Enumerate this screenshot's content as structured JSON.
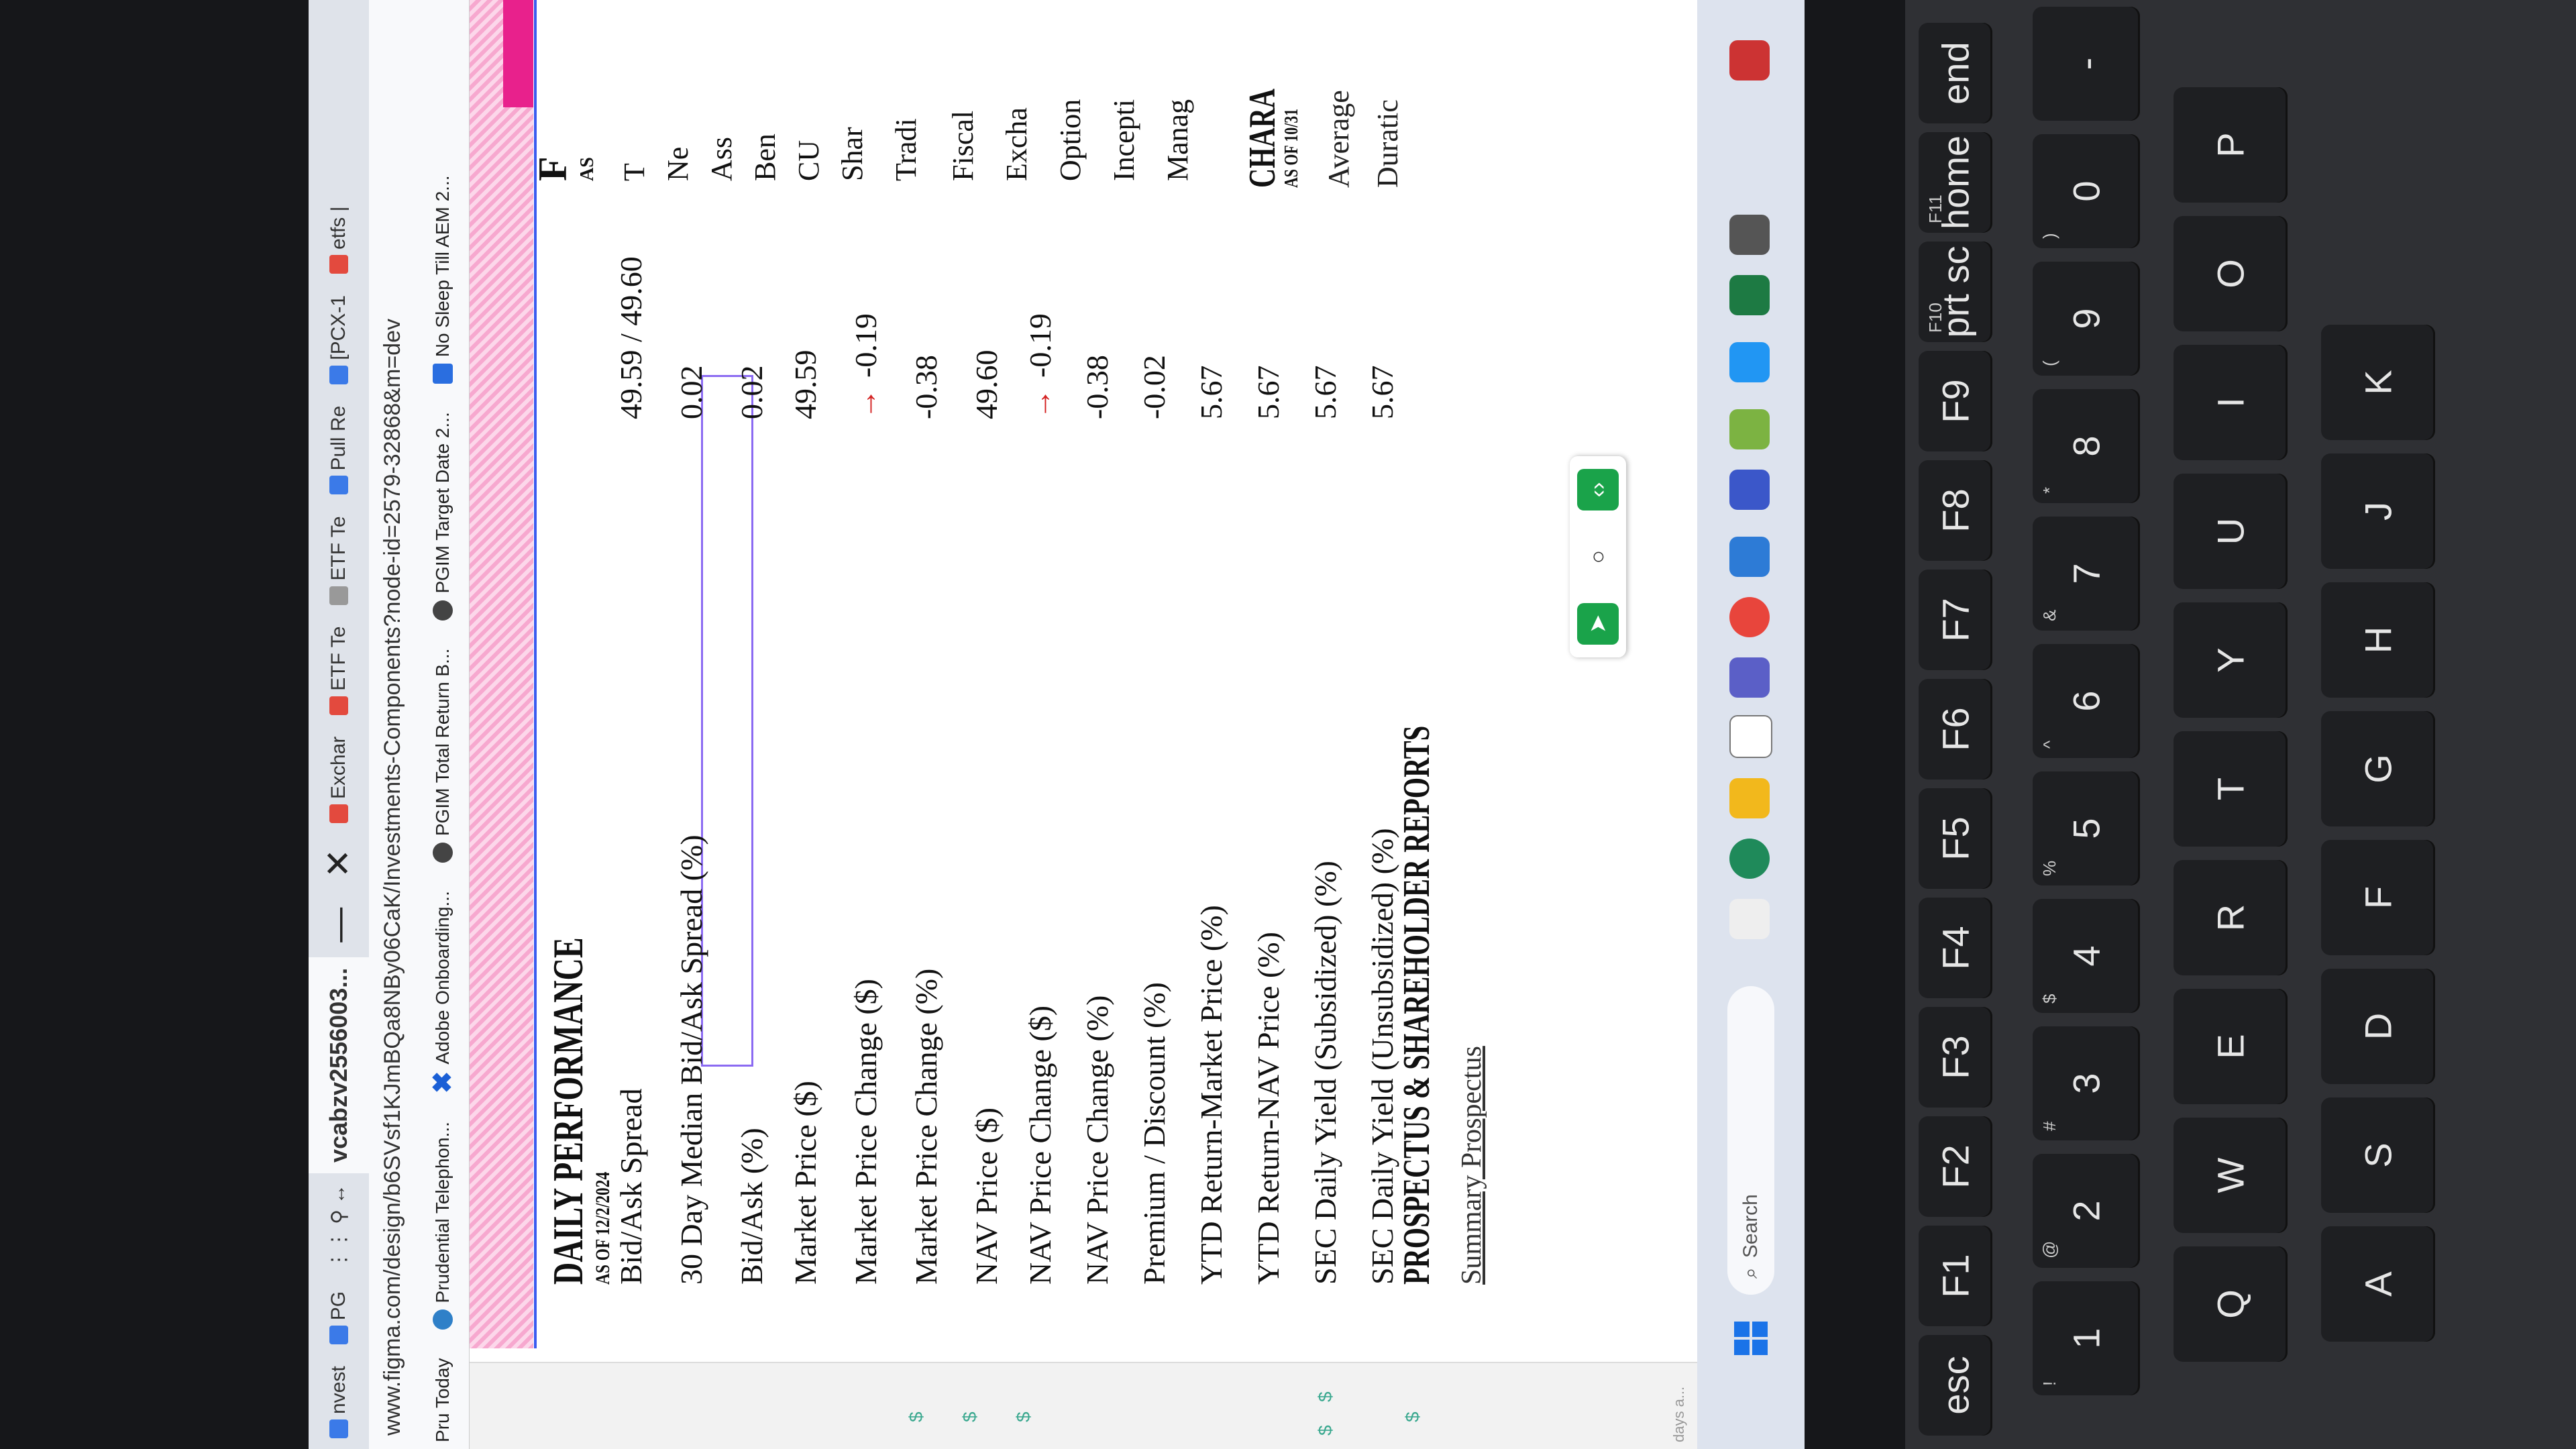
{
  "browser": {
    "tabs": [
      {
        "label": "nvest",
        "color": "#3b7ae8"
      },
      {
        "label": "PG",
        "color": "#3b7ae8"
      },
      {
        "label": "vcabzv2556003...",
        "color": "#555555",
        "active": true
      },
      {
        "label": "Exchar",
        "color": "#e34a3e"
      },
      {
        "label": "ETF Te",
        "color": "#888888"
      },
      {
        "label": "ETF Te",
        "color": "#888888"
      },
      {
        "label": "Pull Re",
        "color": "#3b7ae8"
      },
      {
        "label": "[PCX-1",
        "color": "#3b7ae8"
      },
      {
        "label": "etfs |",
        "color": "#e34a3e"
      }
    ],
    "close_glyph": "✕",
    "minimize_glyph": "—",
    "url": "www.figma.com/design/b6SVsf1KJmBQa8NBy06CaK/Investments-Components?node-id=2579-32868&m=dev",
    "bookmarks": [
      {
        "label": "Pru Today",
        "icon": "pru-icon"
      },
      {
        "label": "Prudential Telephon...",
        "icon": "globe-icon"
      },
      {
        "label": "Adobe Onboarding...",
        "icon": "adobe-x-icon"
      },
      {
        "label": "PGIM Total Return B...",
        "icon": "pgim-icon"
      },
      {
        "label": "PGIM Target Date 2...",
        "icon": "pgim-icon"
      },
      {
        "label": "No Sleep Till AEM 2...",
        "icon": "confluence-icon"
      }
    ]
  },
  "daily_performance": {
    "title": "DAILY PERFORMANCE",
    "as_of": "AS OF 12/2/2024",
    "rows": [
      {
        "label": "Bid/Ask Spread",
        "value": "49.59 / 49.60",
        "down": false
      },
      {
        "label": "30 Day Median Bid/Ask Spread (%)",
        "value": "0.02",
        "down": false
      },
      {
        "label": "Bid/Ask (%)",
        "value": "0.02",
        "down": false
      },
      {
        "label": "Market Price ($)",
        "value": "49.59",
        "down": false
      },
      {
        "label": "Market Price Change ($)",
        "value": "-0.19",
        "down": true
      },
      {
        "label": "Market Price Change (%)",
        "value": "-0.38",
        "down": false
      },
      {
        "label": "NAV Price ($)",
        "value": "49.60",
        "down": false
      },
      {
        "label": "NAV Price Change ($)",
        "value": "-0.19",
        "down": true
      },
      {
        "label": "NAV Price Change (%)",
        "value": "-0.38",
        "down": false
      },
      {
        "label": "Premium / Discount (%)",
        "value": "-0.02",
        "down": false
      },
      {
        "label": "YTD Return-Market Price (%)",
        "value": "5.67",
        "down": false
      },
      {
        "label": "YTD Return-NAV Price (%)",
        "value": "5.67",
        "down": false
      },
      {
        "label": "SEC Daily Yield (Subsidized) (%)",
        "value": "5.67",
        "down": false
      },
      {
        "label": "SEC Daily Yield (Unsubsidized) (%)",
        "value": "5.67",
        "down": false
      }
    ]
  },
  "right_column": {
    "heading": "F",
    "as_of": "AS",
    "items": [
      "T",
      "Ne",
      "Ass",
      "Ben",
      "CU",
      "Shar",
      "Tradi",
      "Fiscal",
      "Excha",
      "Option",
      "Incepti",
      "Manag"
    ]
  },
  "characteristics": {
    "title": "CHARA",
    "as_of": "AS OF 10/31",
    "items": [
      "Average",
      "Duratic"
    ]
  },
  "prospectus": {
    "title": "PROSPECTUS & SHAREHOLDER REPORTS",
    "link": "Summary Prospectus"
  },
  "sidebar": {
    "dollar": "$",
    "label": "days a..."
  },
  "taskbar": {
    "search_placeholder": "Search",
    "apps": [
      "file-explorer-icon",
      "edge-icon",
      "store-icon",
      "teams-icon",
      "chrome-icon",
      "outlook-icon",
      "teams-chat-icon",
      "calendar-icon",
      "visual-studio-icon",
      "excel-icon",
      "snipping-icon"
    ]
  },
  "keyboard": {
    "fn_row": [
      {
        "main": "esc"
      },
      {
        "main": "F1"
      },
      {
        "main": "F2"
      },
      {
        "main": "F3"
      },
      {
        "main": "F4"
      },
      {
        "main": "F5"
      },
      {
        "main": "F6"
      },
      {
        "main": "F7"
      },
      {
        "main": "F8"
      },
      {
        "main": "F9"
      },
      {
        "main": "prt sc",
        "sub": "F10"
      },
      {
        "main": "home",
        "sub": "F11"
      },
      {
        "main": "end"
      }
    ],
    "num_row": [
      {
        "main": "1",
        "sub": "!"
      },
      {
        "main": "2",
        "sub": "@"
      },
      {
        "main": "3",
        "sub": "#"
      },
      {
        "main": "4",
        "sub": "$"
      },
      {
        "main": "5",
        "sub": "%"
      },
      {
        "main": "6",
        "sub": "^"
      },
      {
        "main": "7",
        "sub": "&"
      },
      {
        "main": "8",
        "sub": "*"
      },
      {
        "main": "9",
        "sub": "("
      },
      {
        "main": "0",
        "sub": ")"
      },
      {
        "main": "-"
      }
    ],
    "q_row": [
      "Q",
      "W",
      "E",
      "R",
      "T",
      "Y",
      "U",
      "I",
      "O",
      "P"
    ],
    "a_row": [
      "A",
      "S",
      "D",
      "F",
      "G",
      "H",
      "J",
      "K"
    ]
  }
}
